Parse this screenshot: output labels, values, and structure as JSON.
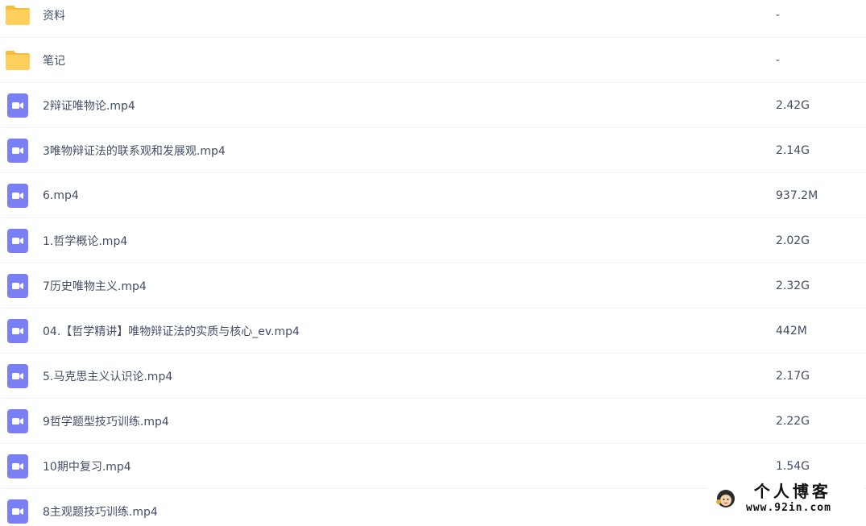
{
  "files": [
    {
      "name": "资料",
      "size": "-",
      "type": "folder"
    },
    {
      "name": "笔记",
      "size": "-",
      "type": "folder"
    },
    {
      "name": "2辩证唯物论.mp4",
      "size": "2.42G",
      "type": "video"
    },
    {
      "name": "3唯物辩证法的联系观和发展观.mp4",
      "size": "2.14G",
      "type": "video"
    },
    {
      "name": "6.mp4",
      "size": "937.2M",
      "type": "video"
    },
    {
      "name": "1.哲学概论.mp4",
      "size": "2.02G",
      "type": "video"
    },
    {
      "name": "7历史唯物主义.mp4",
      "size": "2.32G",
      "type": "video"
    },
    {
      "name": "04.【哲学精讲】唯物辩证法的实质与核心_ev.mp4",
      "size": "442M",
      "type": "video"
    },
    {
      "name": "5.马克思主义认识论.mp4",
      "size": "2.17G",
      "type": "video"
    },
    {
      "name": "9哲学题型技巧训练.mp4",
      "size": "2.22G",
      "type": "video"
    },
    {
      "name": "10期中复习.mp4",
      "size": "1.54G",
      "type": "video"
    },
    {
      "name": "8主观题技巧训练.mp4",
      "size": "",
      "type": "video"
    }
  ],
  "colors": {
    "folder": "#ffd15c",
    "folder_tab": "#f5bd3c",
    "video": "#7b7ff5",
    "text": "#424e67",
    "divider": "#f0f0f3"
  },
  "icons": {
    "folder": "folder-icon",
    "video": "video-file-icon"
  },
  "watermark": {
    "title": "个人博客",
    "url": "www.92in.com"
  }
}
